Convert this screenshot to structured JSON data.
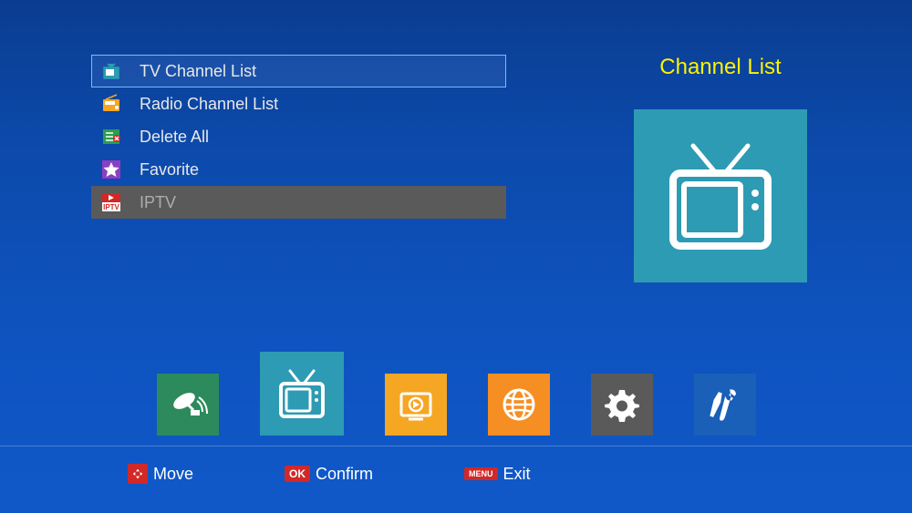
{
  "menu": {
    "items": [
      {
        "label": "TV Channel List",
        "icon_color": "#2d9bb3"
      },
      {
        "label": "Radio Channel List",
        "icon_color": "#f5a623"
      },
      {
        "label": "Delete All",
        "icon_color": "#2c9e4f"
      },
      {
        "label": "Favorite",
        "icon_color": "#8c3fc2"
      },
      {
        "label": "IPTV",
        "icon_color": "#ffffff"
      }
    ],
    "selected_index": 0,
    "disabled_index": 4
  },
  "section_title": "Channel List",
  "nav": {
    "active_index": 1,
    "items": [
      {
        "name": "satellite"
      },
      {
        "name": "channel"
      },
      {
        "name": "media"
      },
      {
        "name": "network"
      },
      {
        "name": "settings"
      },
      {
        "name": "tools"
      }
    ]
  },
  "hints": {
    "move": "Move",
    "confirm": "Confirm",
    "exit": "Exit",
    "ok_badge": "OK",
    "menu_badge": "MENU"
  }
}
